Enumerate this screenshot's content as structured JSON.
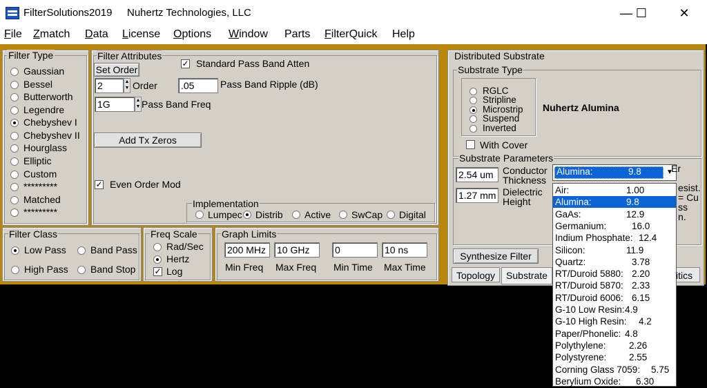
{
  "window": {
    "app_title": "FilterSolutions2019",
    "company": "Nuhertz Technologies, LLC",
    "controls": {
      "minimize": "—",
      "maximize": "☐",
      "close": "✕"
    }
  },
  "menu": [
    "File",
    "Zmatch",
    "Data",
    "License",
    "Options",
    "Window",
    "Parts",
    "FilterQuick",
    "Help"
  ],
  "filter_type": {
    "title": "Filter Type",
    "options": [
      "Gaussian",
      "Bessel",
      "Butterworth",
      "Legendre",
      "Chebyshev I",
      "Chebyshev II",
      "Hourglass",
      "Elliptic",
      "Custom",
      "*********",
      "Matched",
      "*********"
    ],
    "selected": "Chebyshev I"
  },
  "filter_attributes": {
    "title": "Filter Attributes",
    "set_order": "Set Order",
    "order_value": "2",
    "order_label": "Order",
    "ripple_value": ".05",
    "ripple_label": "Pass Band Ripple (dB)",
    "std_atten_label": "Standard Pass Band Atten",
    "freq_value": "1G",
    "freq_label": "Pass Band Freq",
    "add_tx_zeros": "Add Tx Zeros",
    "even_order": "Even Order Mod",
    "implementation_title": "Implementation",
    "implementation_options": [
      "Lumpec",
      "Distrib",
      "Active",
      "SwCap",
      "Digital"
    ],
    "implementation_selected": "Distrib"
  },
  "filter_class": {
    "title": "Filter Class",
    "options": [
      "Low Pass",
      "Band Pass",
      "High Pass",
      "Band Stop"
    ],
    "selected": "Low Pass"
  },
  "freq_scale": {
    "title": "Freq Scale",
    "options": [
      "Rad/Sec",
      "Hertz"
    ],
    "selected": "Hertz",
    "log_label": "Log"
  },
  "graph_limits": {
    "title": "Graph Limits",
    "min_freq": "200 MHz",
    "max_freq": "10 GHz",
    "min_time": "0",
    "max_time": "10 ns",
    "labels": [
      "Min Freq",
      "Max Freq",
      "Min Time",
      "Max Time"
    ]
  },
  "distributed_substrate": {
    "title": "Distributed Substrate",
    "substrate_type_title": "Substrate Type",
    "types": [
      "RGLC",
      "Stripline",
      "Microstrip",
      "Suspend",
      "Inverted"
    ],
    "type_selected": "Microstrip",
    "with_cover": "With Cover",
    "substrate_name": "Nuhertz Alumina",
    "params_title": "Substrate Parameters",
    "conductor_thickness_value": "2.54 um",
    "conductor_label_1": "Conductor",
    "conductor_label_2": "Thickness",
    "dielectric_height_value": "1.27 mm",
    "dielectric_label_1": "Dielectric",
    "dielectric_label_2": "Height",
    "combo_name": "Alumina:",
    "combo_value": "9.8",
    "er_label": "Er",
    "partial_1": "esist.",
    "partial_2": "= Cu",
    "partial_3": "ss",
    "partial_4": "n.",
    "synthesize": "Synthesize Filter",
    "tabs": [
      "Topology",
      "Substrate",
      "itics"
    ]
  },
  "dropdown": [
    {
      "name": "Air:",
      "value": "1.00"
    },
    {
      "name": "Alumina:",
      "value": "9.8"
    },
    {
      "name": "GaAs:",
      "value": "12.9"
    },
    {
      "name": "Germanium:",
      "value": "16.0"
    },
    {
      "name": "Indium Phosphate:",
      "value": "12.4"
    },
    {
      "name": "Silicon:",
      "value": "11.9"
    },
    {
      "name": "Quartz:",
      "value": "3.78"
    },
    {
      "name": "RT/Duroid 5880:",
      "value": "2.20"
    },
    {
      "name": "RT/Duroid 5870:",
      "value": "2.33"
    },
    {
      "name": "RT/Duroid 6006:",
      "value": "6.15"
    },
    {
      "name": "G-10 Low Resin:",
      "value": "4.9"
    },
    {
      "name": "G-10 High Resin:",
      "value": "4.2"
    },
    {
      "name": "Paper/Phonelic:",
      "value": "4.8"
    },
    {
      "name": "Polythylene:",
      "value": "2.26"
    },
    {
      "name": "Polystyrene:",
      "value": "2.55"
    },
    {
      "name": "Corning Glass 7059:",
      "value": "5.75"
    },
    {
      "name": "Berylium Oxide:",
      "value": "6.30"
    }
  ],
  "dropdown_selected": "Alumina:",
  "colors": {
    "background": "#b8860b",
    "panel": "#d4d0c8",
    "selection": "#0a64d6"
  }
}
